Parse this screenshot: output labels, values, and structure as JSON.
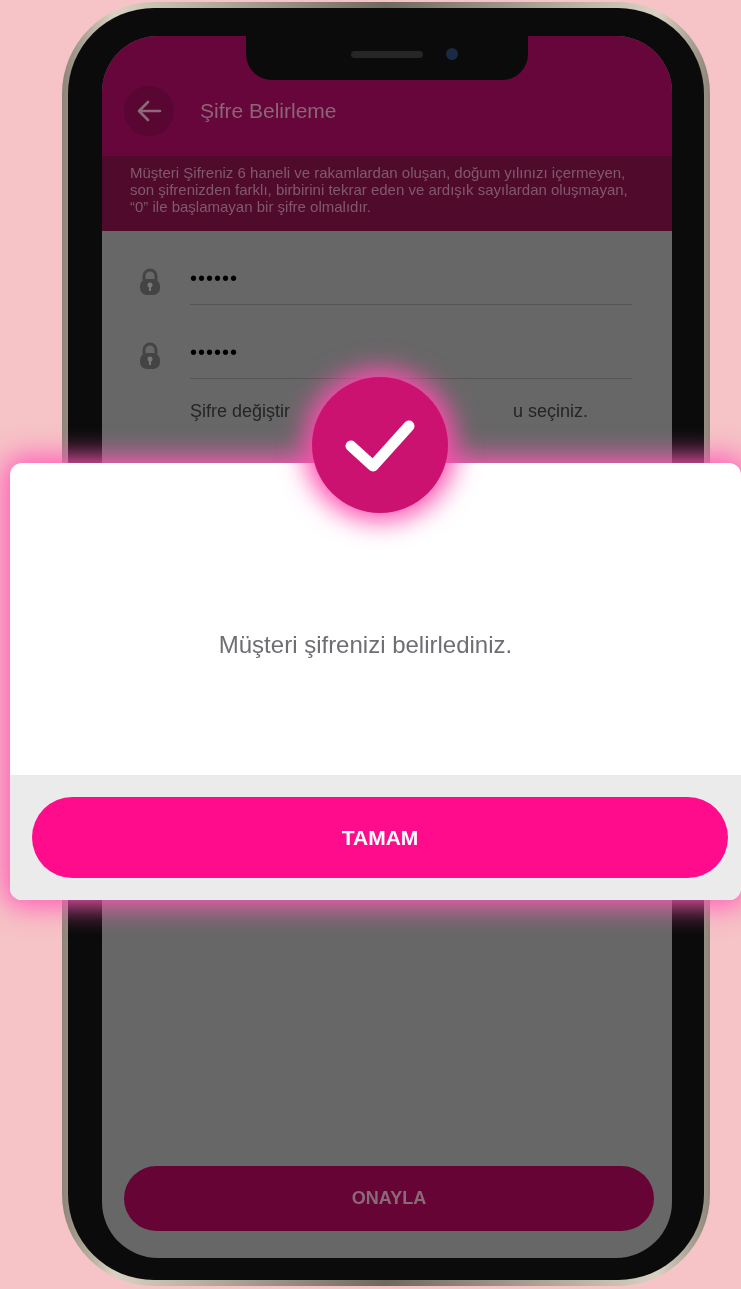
{
  "header": {
    "title": "Şifre Belirleme"
  },
  "info": "Müşteri Şifreniz 6 haneli ve rakamlardan oluşan, doğum yılınızı içermeyen, son şifrenizden farklı, birbirini tekrar eden ve ardışık sayılardan oluşmayan, “0” ile başlamayan bir şifre olmalıdır.",
  "fields": [
    {
      "value": "••••••"
    },
    {
      "value": "••••••"
    }
  ],
  "hint": {
    "visible_start": "Şifre değiştir",
    "visible_end": "u seçiniz."
  },
  "confirm_button": "ONAYLA",
  "dialog": {
    "message": "Müşteri şifrenizi belirlediniz.",
    "button": "TAMAM"
  }
}
